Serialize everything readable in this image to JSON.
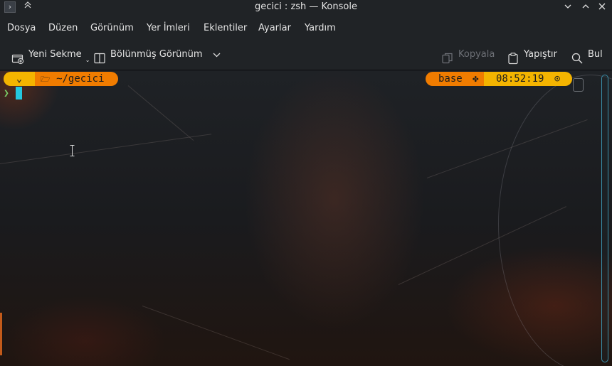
{
  "window": {
    "title": "gecici : zsh — Konsole",
    "icons": {
      "app": "konsole-app-icon",
      "keep_above": "keep-above-icon",
      "minimize": "minimize-icon",
      "maximize": "maximize-icon",
      "close": "close-icon"
    }
  },
  "menu": {
    "items": [
      "Dosya",
      "Düzen",
      "Görünüm",
      "Yer İmleri",
      "Eklentiler",
      "Ayarlar",
      "Yardım"
    ]
  },
  "toolbar": {
    "new_tab_label": "Yeni Sekme",
    "split_view_label": "Bölünmüş Görünüm",
    "copy_label": "Kopyala",
    "paste_label": "Yapıştır",
    "find_label": "Bul"
  },
  "terminal": {
    "prompt": {
      "os_glyph": "⌄",
      "directory": "~/gecici",
      "env_name": "base",
      "time": "08:52:19",
      "prompt_char": "❯"
    },
    "colors": {
      "segment_yellow": "#f4b400",
      "segment_orange": "#f07c00",
      "cursor": "#23c8e0",
      "prompt_char": "#7bd36b"
    }
  }
}
